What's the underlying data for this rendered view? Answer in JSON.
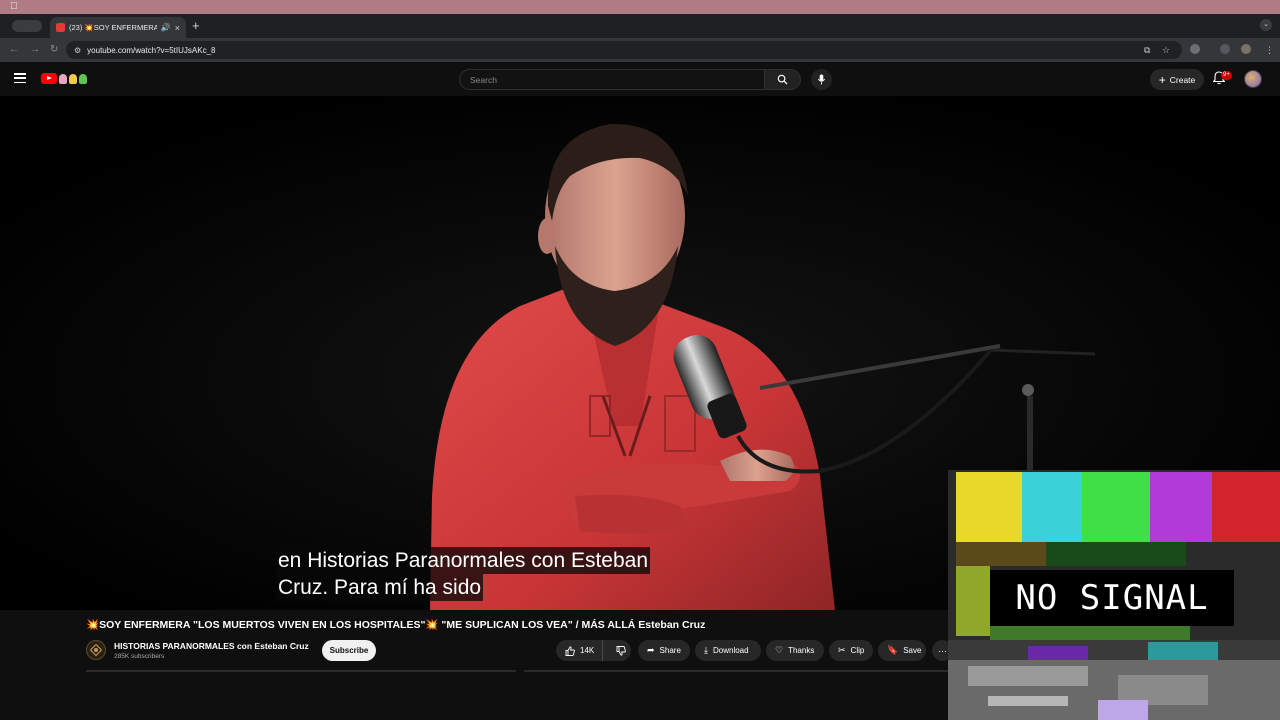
{
  "browser": {
    "tab_title": "(23) 💥SOY ENFERMERA",
    "url": "youtube.com/watch?v=5tIUJsAKc_8",
    "new_tab_glyph": "+",
    "close_glyph": "×"
  },
  "masthead": {
    "search_placeholder": "Search",
    "create_label": "Create",
    "notification_badge": "9+"
  },
  "video": {
    "caption_lines": [
      "en Historias Paranormales con Esteban",
      "Cruz. Para mí ha sido"
    ],
    "overlay_text": "NO SIGNAL"
  },
  "meta": {
    "title": "💥SOY ENFERMERA \"LOS MUERTOS VIVEN EN LOS HOSPITALES\"💥 \"ME SUPLICAN LOS VEA\" / MÁS ALLÁ Esteban Cruz",
    "channel_name": "HISTORIAS PARANORMALES con Esteban Cruz",
    "subscribers": "285K subscribers",
    "subscribe_label": "Subscribe",
    "like_count": "14K",
    "share_label": "Share",
    "download_label": "Download",
    "thanks_label": "Thanks",
    "clip_label": "Clip",
    "save_label": "Save"
  },
  "icons": {
    "apple": "apple-icon",
    "menu": "hamburger-menu-icon",
    "search": "magnifier-icon",
    "mic": "microphone-icon",
    "bell": "bell-icon",
    "like": "thumbs-up-icon",
    "dislike": "thumbs-down-icon",
    "share": "share-arrow-icon",
    "download": "download-icon",
    "thanks": "heart-dollar-icon",
    "clip": "scissors-icon",
    "save": "bookmark-icon",
    "more": "more-horizontal-icon"
  },
  "colors": {
    "youtube_red": "#ff0000",
    "shirt_red": "#d13a3c",
    "mac_menubar": "#b07c84",
    "page_bg": "#0f0f0f"
  }
}
